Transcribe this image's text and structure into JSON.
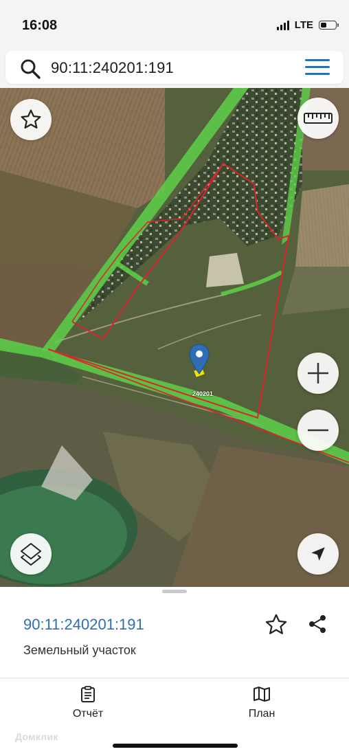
{
  "status_bar": {
    "time": "16:08",
    "network": "LTE",
    "battery_level": 0.4
  },
  "search": {
    "value": "90:11:240201:191",
    "search_icon": "search-icon",
    "menu_icon": "hamburger-menu-icon"
  },
  "map": {
    "quarter_label": "240201",
    "controls": {
      "favorite_icon": "star-outline-icon",
      "ruler_icon": "ruler-icon",
      "zoom_in_icon": "plus-icon",
      "zoom_out_icon": "minus-icon",
      "layers_icon": "layers-icon",
      "locate_icon": "location-arrow-icon"
    },
    "colors": {
      "parcel_boundary": "#d8262b",
      "zone_boundary": "#5ed04a",
      "selected_parcel": "#f2e600",
      "pin": "#2f6db5"
    }
  },
  "details": {
    "cadastral_number": "90:11:240201:191",
    "object_type": "Земельный участок",
    "favorite_icon": "star-outline-icon",
    "share_icon": "share-icon"
  },
  "bottom_nav": {
    "report_label": "Отчёт",
    "report_icon": "clipboard-icon",
    "plan_label": "План",
    "plan_icon": "map-icon"
  },
  "watermark": "Домклик",
  "accent_color": "#2f6db5"
}
